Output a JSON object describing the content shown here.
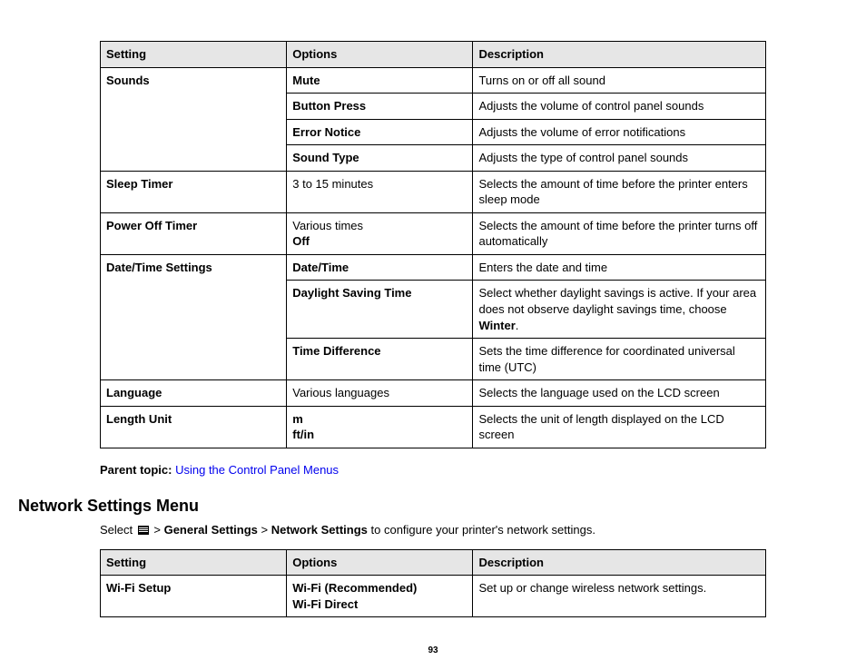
{
  "table1": {
    "headers": [
      "Setting",
      "Options",
      "Description"
    ],
    "rows": {
      "sounds": {
        "setting": "Sounds",
        "opts": [
          "Mute",
          "Button Press",
          "Error Notice",
          "Sound Type"
        ],
        "descs": [
          "Turns on or off all sound",
          "Adjusts the volume of control panel sounds",
          "Adjusts the volume of error notifications",
          "Adjusts the type of control panel sounds"
        ]
      },
      "sleep": {
        "setting": "Sleep Timer",
        "opt": "3 to 15 minutes",
        "desc": "Selects the amount of time before the printer enters sleep mode"
      },
      "power": {
        "setting": "Power Off Timer",
        "opt1": "Various times",
        "opt2": "Off",
        "desc": "Selects the amount of time before the printer turns off automatically"
      },
      "datetime": {
        "setting": "Date/Time Settings",
        "opts": [
          "Date/Time",
          "Daylight Saving Time",
          "Time Difference"
        ],
        "desc1": "Enters the date and time",
        "desc2_pre": "Select whether daylight savings is active. If your area does not observe daylight savings time, choose ",
        "desc2_bold": "Winter",
        "desc2_post": ".",
        "desc3": "Sets the time difference for coordinated universal time (UTC)"
      },
      "language": {
        "setting": "Language",
        "opt": "Various languages",
        "desc": "Selects the language used on the LCD screen"
      },
      "length": {
        "setting": "Length Unit",
        "opt1": "m",
        "opt2": "ft/in",
        "desc": "Selects the unit of length displayed on the LCD screen"
      }
    }
  },
  "parent": {
    "label": "Parent topic:",
    "link": "Using the Control Panel Menus"
  },
  "heading": "Network Settings Menu",
  "intro": {
    "pre": "Select ",
    "gs": "General Settings",
    "sep": " > ",
    "ns": "Network Settings",
    "post": " to configure your printer's network settings."
  },
  "table2": {
    "headers": [
      "Setting",
      "Options",
      "Description"
    ],
    "setting": "Wi-Fi Setup",
    "opt1": "Wi-Fi (Recommended)",
    "opt2": "Wi-Fi Direct",
    "desc": "Set up or change wireless network settings."
  },
  "page": "93"
}
